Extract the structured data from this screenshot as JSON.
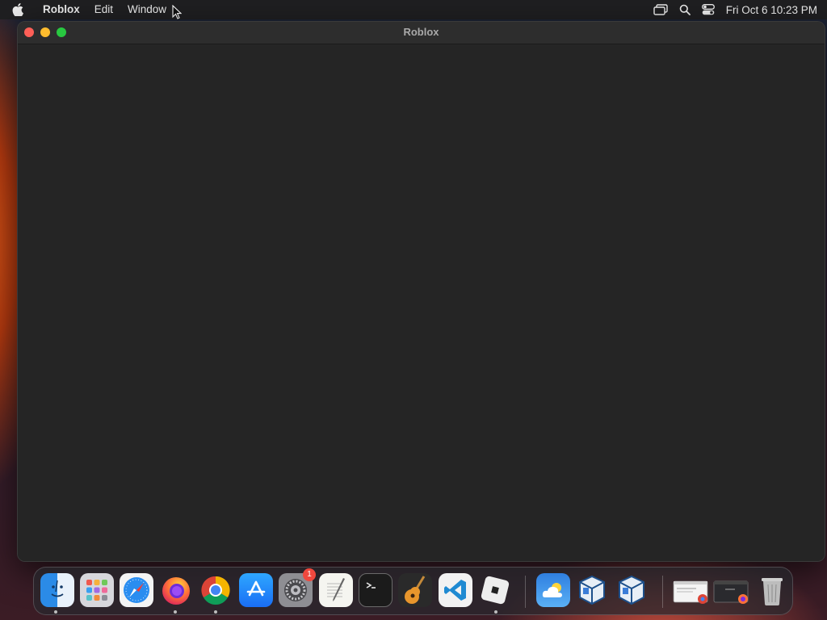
{
  "menubar": {
    "apple_icon": "apple-icon",
    "items": [
      {
        "label": "Roblox",
        "bold": true
      },
      {
        "label": "Edit"
      },
      {
        "label": "Window"
      }
    ],
    "status_icons": [
      "screen-mirroring-icon",
      "spotlight-search-icon",
      "control-center-icon"
    ],
    "clock": "Fri Oct 6  10:23 PM"
  },
  "window": {
    "title": "Roblox",
    "traffic_colors": {
      "close": "#fe5f57",
      "minimize": "#febc2e",
      "zoom": "#28c840"
    }
  },
  "dock": {
    "apps": [
      {
        "name": "Finder",
        "icon": "finder-icon",
        "running": true
      },
      {
        "name": "Launchpad",
        "icon": "launchpad-icon",
        "running": false
      },
      {
        "name": "Safari",
        "icon": "safari-icon",
        "running": false
      },
      {
        "name": "Firefox",
        "icon": "firefox-icon",
        "running": true
      },
      {
        "name": "Google Chrome",
        "icon": "chrome-icon",
        "running": true
      },
      {
        "name": "App Store",
        "icon": "app-store-icon",
        "running": false
      },
      {
        "name": "System Settings",
        "icon": "system-settings-icon",
        "running": false,
        "badge": "1"
      },
      {
        "name": "TextEdit",
        "icon": "textedit-icon",
        "running": false
      },
      {
        "name": "Terminal",
        "icon": "terminal-icon",
        "running": false
      },
      {
        "name": "GarageBand",
        "icon": "garageband-icon",
        "running": false
      },
      {
        "name": "Visual Studio Code",
        "icon": "vscode-icon",
        "running": false
      },
      {
        "name": "Roblox",
        "icon": "roblox-icon",
        "running": true
      },
      {
        "name": "Weather",
        "icon": "weather-icon",
        "running": false
      },
      {
        "name": "VirtualBox",
        "icon": "virtualbox-icon",
        "running": false
      },
      {
        "name": "VirtualBox",
        "icon": "virtualbox-icon",
        "running": false
      },
      {
        "name": "Chrome window",
        "icon": "minimized-chrome-window-icon",
        "running": false
      },
      {
        "name": "Firefox window",
        "icon": "minimized-firefox-window-icon",
        "running": false
      },
      {
        "name": "Trash",
        "icon": "trash-icon",
        "running": false
      }
    ]
  }
}
